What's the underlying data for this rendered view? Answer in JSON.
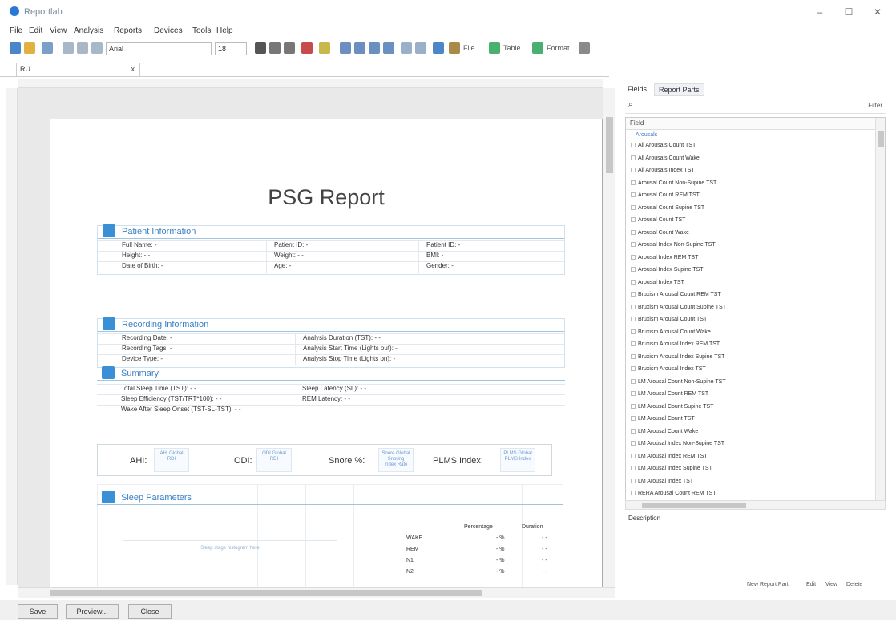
{
  "window": {
    "title": "Reportlab"
  },
  "menu": [
    "File",
    "Edit",
    "View",
    "Analysis",
    "Reports",
    "Devices",
    "Tools",
    "Help"
  ],
  "toolbar": {
    "font": "Arial",
    "size": "18",
    "file_label": "File",
    "table_label": "Table",
    "format_label": "Format"
  },
  "tab": {
    "label": "RU",
    "close": "x"
  },
  "report": {
    "title": "PSG Report",
    "patient": {
      "heading": "Patient Information",
      "rows": [
        [
          "Full Name: -",
          "Patient ID: -",
          "Patient ID: -"
        ],
        [
          "Height: - -",
          "Weight: - -",
          "BMI: -"
        ],
        [
          "Date of Birth: -",
          "Age: -",
          "Gender: -"
        ]
      ]
    },
    "recording": {
      "heading": "Recording Information",
      "rows": [
        [
          "Recording Date: -",
          "Analysis Duration (TST): - -"
        ],
        [
          "Recording Tags: -",
          "Analysis Start Time (Lights out): -"
        ],
        [
          "Device Type: -",
          "Analysis Stop Time (Lights on): -"
        ]
      ]
    },
    "summary": {
      "heading": "Summary",
      "rows": [
        [
          "Total Sleep Time (TST): - -",
          "Sleep Latency (SL): - -"
        ],
        [
          "Sleep Efficiency (TST/TRT*100): - -",
          "REM Latency: - -"
        ],
        [
          "Wake After Sleep Onset (TST-SL-TST): - -",
          ""
        ]
      ]
    },
    "kpis": [
      {
        "label": "AHI:",
        "ph": "AHI Global\nRDI"
      },
      {
        "label": "ODI:",
        "ph": "ODI Global\nRDI"
      },
      {
        "label": "Snore %:",
        "ph": "Snore Global\nSnoring\nIndex Rate"
      },
      {
        "label": "PLMS Index:",
        "ph": "PLMS Global\nPLMS Index"
      }
    ],
    "sleep": {
      "heading": "Sleep Parameters",
      "hypno_label": "Sleep stage histogram here",
      "col1": "Percentage",
      "col2": "Duration",
      "stages": [
        {
          "name": "WAKE",
          "pct": "- %",
          "dur": "- -"
        },
        {
          "name": "REM",
          "pct": "- %",
          "dur": "- -"
        },
        {
          "name": "N1",
          "pct": "- %",
          "dur": "- -"
        },
        {
          "name": "N2",
          "pct": "- %",
          "dur": "- -"
        }
      ]
    }
  },
  "panel": {
    "tabs": [
      "Fields",
      "Report Parts"
    ],
    "filter": "Filter",
    "list_header": "Field",
    "category": "Arousals",
    "items": [
      "All Arousals Count TST",
      "All Arousals Count Wake",
      "All Arousals Index TST",
      "Arousal Count Non-Supine TST",
      "Arousal Count REM TST",
      "Arousal Count Supine TST",
      "Arousal Count TST",
      "Arousal Count Wake",
      "Arousal Index Non-Supine TST",
      "Arousal Index REM TST",
      "Arousal Index Supine TST",
      "Arousal Index TST",
      "Bruxism Arousal Count REM TST",
      "Bruxism Arousal Count Supine TST",
      "Bruxism Arousal Count TST",
      "Bruxism Arousal Count Wake",
      "Bruxism Arousal Index REM TST",
      "Bruxism Arousal Index Supine TST",
      "Bruxism Arousal Index TST",
      "LM Arousal Count Non-Supine TST",
      "LM Arousal Count REM TST",
      "LM Arousal Count Supine TST",
      "LM Arousal Count TST",
      "LM Arousal Count Wake",
      "LM Arousal Index Non-Supine TST",
      "LM Arousal Index REM TST",
      "LM Arousal Index Supine TST",
      "LM Arousal Index TST",
      "RERA Arousal Count REM TST"
    ],
    "description": "Description",
    "actions": [
      "New Report Part",
      "Edit",
      "View",
      "Delete"
    ]
  },
  "buttons": {
    "save": "Save",
    "preview": "Preview...",
    "close": "Close"
  }
}
